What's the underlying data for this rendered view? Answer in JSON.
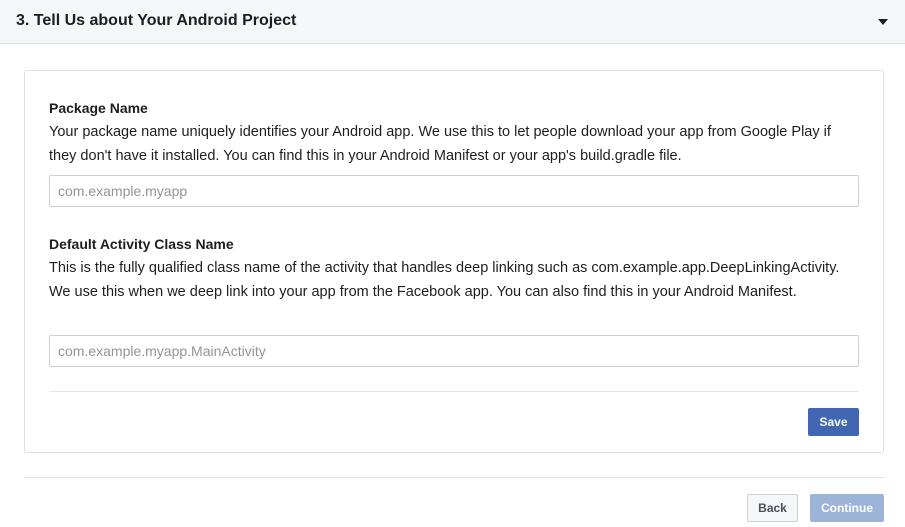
{
  "section": {
    "title": "3. Tell Us about Your Android Project",
    "caret_icon": "caret-down-icon"
  },
  "package_name": {
    "label": "Package Name",
    "description": "Your package name uniquely identifies your Android app. We use this to let people download your app from Google Play if they don't have it installed. You can find this in your Android Manifest or your app's build.gradle file.",
    "value": "",
    "placeholder": "com.example.myapp"
  },
  "activity_class": {
    "label": "Default Activity Class Name",
    "description": "This is the fully qualified class name of the activity that handles deep linking such as com.example.app.DeepLinkingActivity. We use this when we deep link into your app from the Facebook app. You can also find this in your Android Manifest.",
    "value": "",
    "placeholder": "com.example.myapp.MainActivity"
  },
  "card_actions": {
    "save_label": "Save"
  },
  "footer": {
    "back_label": "Back",
    "continue_label": "Continue",
    "continue_disabled": true
  },
  "colors": {
    "primary": "#4267b2",
    "primary_disabled": "#9cb4d8",
    "header_bg": "#f5f6f7",
    "border": "#dddfe2"
  }
}
